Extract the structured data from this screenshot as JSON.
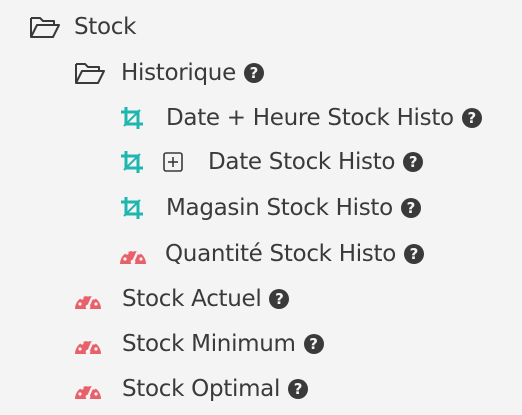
{
  "tree": {
    "root": {
      "label": "Stock",
      "icon": "folder-open-icon",
      "children": {
        "historique": {
          "label": "Historique",
          "icon": "folder-open-icon",
          "help": "?",
          "children": {
            "date_heure": {
              "label": "Date + Heure Stock Histo",
              "icon": "crop-dimension-icon",
              "help": "?"
            },
            "date": {
              "label": "Date Stock Histo",
              "icon": "crop-dimension-icon",
              "expander_icon": "plus-square-icon",
              "help": "?"
            },
            "magasin": {
              "label": "Magasin Stock Histo",
              "icon": "crop-dimension-icon",
              "help": "?"
            },
            "quantite": {
              "label": "Quantité Stock Histo",
              "icon": "gauge-measure-icon",
              "help": "?"
            }
          }
        },
        "actuel": {
          "label": "Stock Actuel",
          "icon": "gauge-measure-icon",
          "help": "?"
        },
        "minimum": {
          "label": "Stock Minimum",
          "icon": "gauge-measure-icon",
          "help": "?"
        },
        "optimal": {
          "label": "Stock Optimal",
          "icon": "gauge-measure-icon",
          "help": "?"
        }
      }
    }
  },
  "colors": {
    "background": "#f4f4f4",
    "text": "#3a3a3a",
    "dimension_icon": "#1fb5b0",
    "measure_icon": "#e8606a"
  }
}
